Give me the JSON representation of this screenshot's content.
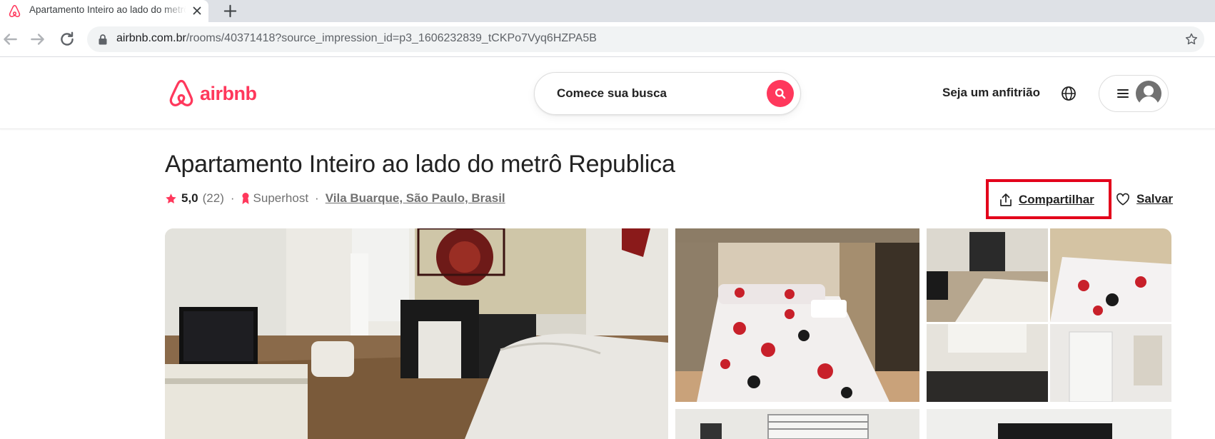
{
  "browser": {
    "tab_title": "Apartamento Inteiro ao lado do metrô Republica - Apartamentos para Alugar em São Paulo",
    "url_host": "airbnb.com.br",
    "url_path": "/rooms/40371418?source_impression_id=p3_1606232839_tCKPo7Vyq6HZPA5B"
  },
  "header": {
    "logo_text": "airbnb",
    "search_placeholder": "Comece sua busca",
    "host_link": "Seja um anfitrião"
  },
  "listing": {
    "title": "Apartamento Inteiro ao lado do metrô Republica",
    "rating": "5,0",
    "reviews": "(22)",
    "separator": "·",
    "superhost": "Superhost",
    "location": "Vila Buarque, São Paulo, Brasil",
    "share_label": "Compartilhar",
    "save_label": "Salvar"
  },
  "colors": {
    "brand": "#ff385c",
    "highlight_box": "#e3001b"
  },
  "icons": [
    "airbnb-logo-icon",
    "back-icon",
    "forward-icon",
    "reload-icon",
    "lock-icon",
    "bookmark-star-icon",
    "search-icon",
    "globe-icon",
    "menu-icon",
    "avatar-icon",
    "star-icon",
    "superhost-icon",
    "share-icon",
    "heart-icon"
  ]
}
